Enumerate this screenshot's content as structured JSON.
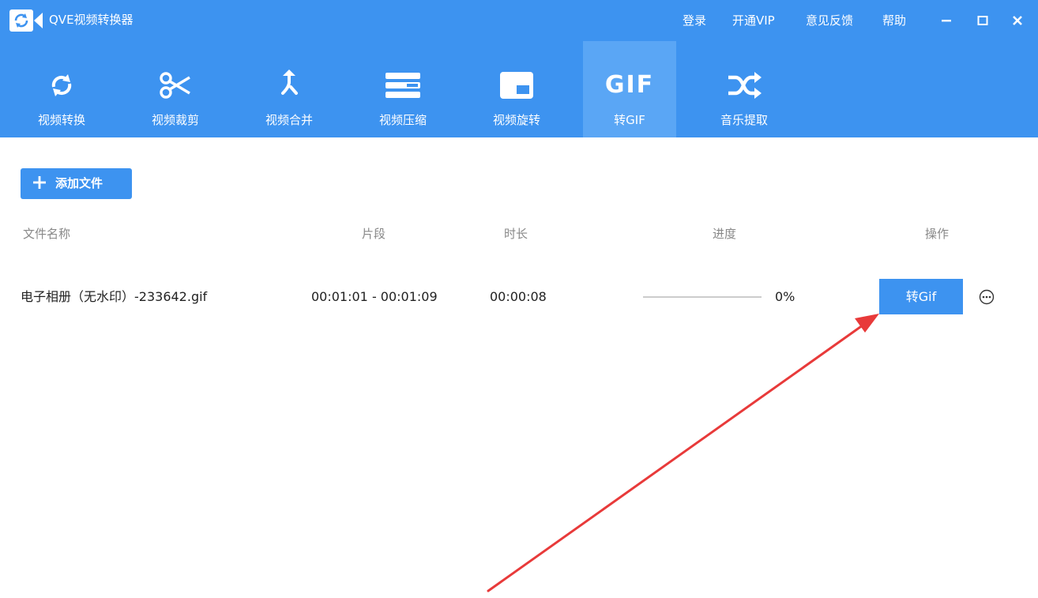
{
  "app": {
    "title": "QVE视频转换器"
  },
  "top_links": [
    {
      "label": "登录"
    },
    {
      "label": "开通VIP"
    },
    {
      "label": "意见反馈"
    },
    {
      "label": "帮助"
    }
  ],
  "toolbar": {
    "tools": [
      {
        "label": "视频转换",
        "icon": "refresh-icon"
      },
      {
        "label": "视频裁剪",
        "icon": "scissors-icon"
      },
      {
        "label": "视频合并",
        "icon": "merge-icon"
      },
      {
        "label": "视频压缩",
        "icon": "compress-icon"
      },
      {
        "label": "视频旋转",
        "icon": "rotate-icon"
      },
      {
        "label": "转GIF",
        "icon": "gif-icon",
        "active": true
      },
      {
        "label": "音乐提取",
        "icon": "shuffle-icon"
      }
    ],
    "gif_icon_text": "GIF"
  },
  "add_file": {
    "label": "添加文件"
  },
  "table": {
    "headers": {
      "name": "文件名称",
      "segment": "片段",
      "duration": "时长",
      "progress": "进度",
      "action": "操作"
    },
    "rows": [
      {
        "name": "电子相册（无水印）-233642.gif",
        "segment": "00:01:01 - 00:01:09",
        "duration": "00:00:08",
        "progress_text": "0%",
        "progress_value": 0,
        "action_label": "转Gif"
      }
    ]
  },
  "colors": {
    "primary": "#3d93f0",
    "active_tab": "#5aa6f5",
    "annotation_arrow": "#e83a3a"
  }
}
